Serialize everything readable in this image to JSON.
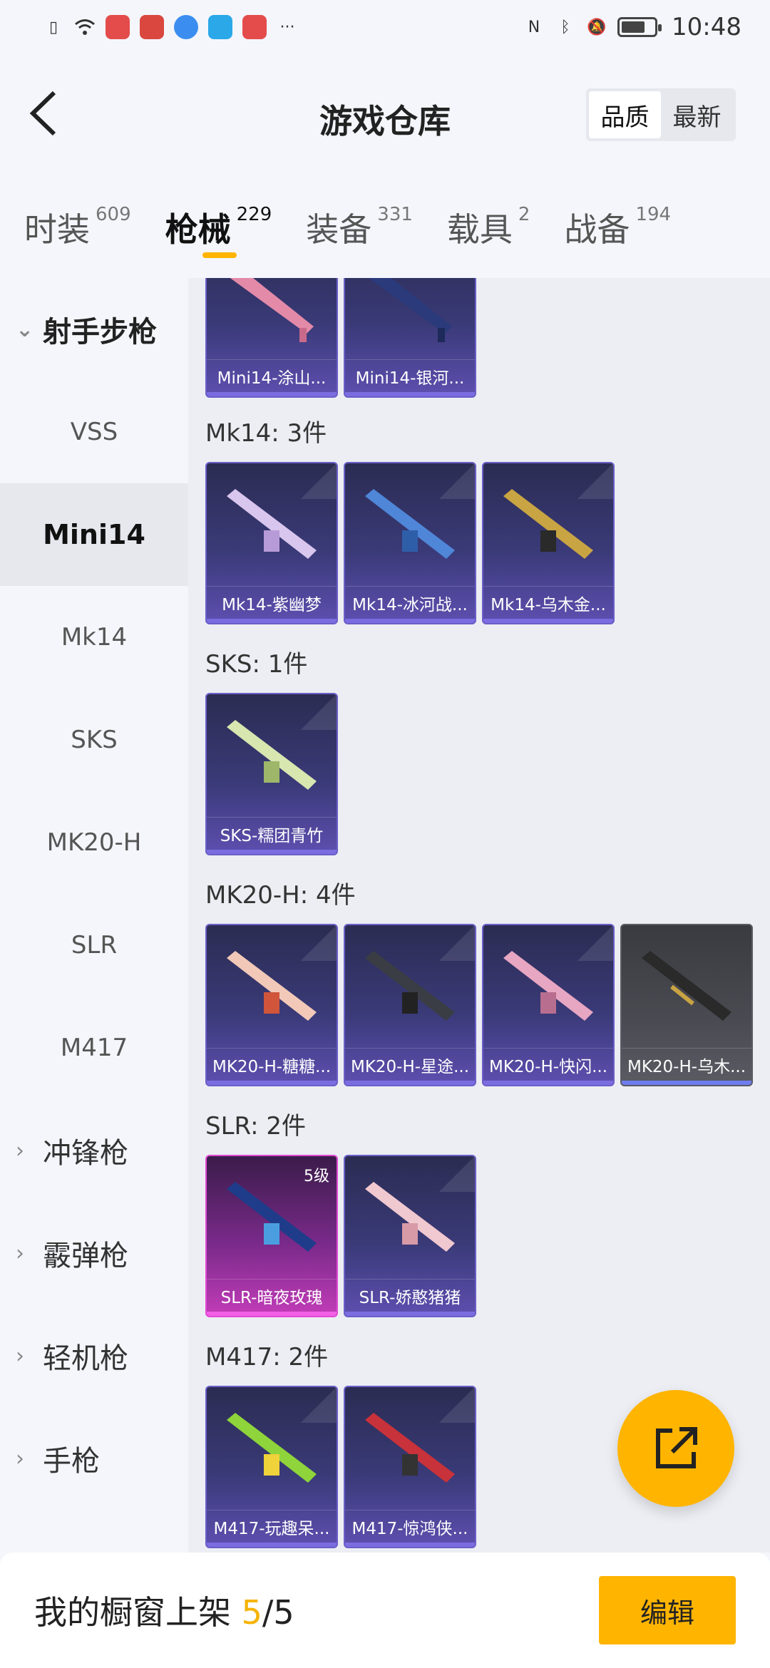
{
  "status_bar": {
    "time": "10:48"
  },
  "header": {
    "title": "游戏仓库",
    "sort_options": [
      "品质",
      "最新"
    ],
    "sort_active_index": 0
  },
  "tabs": [
    {
      "label": "时装",
      "count": "609"
    },
    {
      "label": "枪械",
      "count": "229"
    },
    {
      "label": "装备",
      "count": "331"
    },
    {
      "label": "载具",
      "count": "2"
    },
    {
      "label": "战备",
      "count": "194"
    }
  ],
  "active_tab": "枪械",
  "sidebar": {
    "expanded_group": "射手步枪",
    "sub_items": [
      "VSS",
      "Mini14",
      "Mk14",
      "SKS",
      "MK20-H",
      "SLR",
      "M417"
    ],
    "active_sub_item": "Mini14",
    "collapsed_groups": [
      "冲锋枪",
      "霰弹枪",
      "轻机枪",
      "手枪"
    ]
  },
  "content": {
    "mini14_items": [
      "Mini14-涂山...",
      "Mini14-银河..."
    ],
    "groups": [
      {
        "title": "Mk14: 3件",
        "items": [
          "Mk14-紫幽梦",
          "Mk14-冰河战...",
          "Mk14-乌木金..."
        ]
      },
      {
        "title": "SKS: 1件",
        "items": [
          "SKS-糯团青竹"
        ]
      },
      {
        "title": "MK20-H: 4件",
        "items": [
          "MK20-H-糖糖...",
          "MK20-H-星途...",
          "MK20-H-快闪...",
          "MK20-H-乌木..."
        ]
      },
      {
        "title": "SLR: 2件",
        "items": [
          "SLR-暗夜玫瑰",
          "SLR-娇憨猪猪"
        ],
        "level_badge": "5级"
      },
      {
        "title": "M417: 2件",
        "items": [
          "M417-玩趣呆...",
          "M417-惊鸿侠..."
        ]
      }
    ]
  },
  "bottom_bar": {
    "text_prefix": "我的橱窗上架 ",
    "count_current": "5",
    "count_sep_total": "/5",
    "edit_label": "编辑"
  },
  "colors": {
    "accent": "#ffb400",
    "card_purple": "#5d4fb0",
    "card_pink": "#c23cb8"
  }
}
